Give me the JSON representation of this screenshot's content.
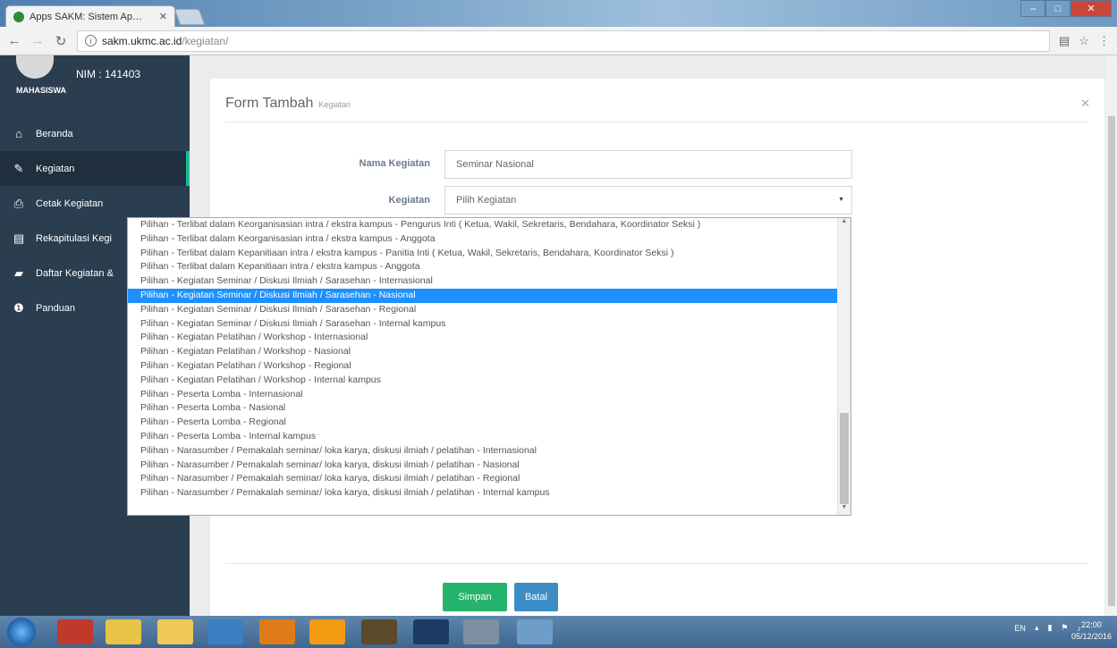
{
  "browser": {
    "tab_title": "Apps SAKM: Sistem Ap…",
    "url_host": "sakm.ukmc.ac.id",
    "url_path": "/kegiatan/"
  },
  "sidebar": {
    "nim": "NIM : 141403",
    "role": "MAHASISWA",
    "items": [
      {
        "label": "Beranda",
        "icon": "home-icon"
      },
      {
        "label": "Kegiatan",
        "icon": "edit-icon"
      },
      {
        "label": "Cetak Kegiatan",
        "icon": "print-icon"
      },
      {
        "label": "Rekapitulasi Kegi",
        "icon": "file-icon"
      },
      {
        "label": "Daftar Kegiatan &",
        "icon": "folder-icon"
      },
      {
        "label": "Panduan",
        "icon": "info-icon"
      }
    ]
  },
  "form": {
    "title": "Form Tambah",
    "subtitle": "Kegiatan",
    "nama_label": "Nama Kegiatan",
    "nama_value": "Seminar Nasional",
    "kegiatan_label": "Kegiatan",
    "kegiatan_value": "Pilih Kegiatan",
    "save_label": "Simpan",
    "cancel_label": "Batal"
  },
  "dropdown": {
    "selected_index": 5,
    "options": [
      "Pilihan - Terlibat dalam Keorganisasian intra / ekstra kampus - Pengurus Inti ( Ketua, Wakil, Sekretaris, Bendahara, Koordinator Seksi )",
      "Pilihan - Terlibat dalam Keorganisasian intra / ekstra kampus - Anggota",
      "Pilihan - Terlibat dalam Kepanitiaan intra / ekstra kampus - Panitia Inti ( Ketua, Wakil, Sekretaris, Bendahara, Koordinator Seksi )",
      "Pilihan - Terlibat dalam Kepanitiaan intra / ekstra kampus - Anggota",
      "Pilihan - Kegiatan Seminar / Diskusi Ilmiah / Sarasehan - Internasional",
      "Pilihan - Kegiatan Seminar / Diskusi Ilmiah / Sarasehan - Nasional",
      "Pilihan - Kegiatan Seminar / Diskusi Ilmiah / Sarasehan - Regional",
      "Pilihan - Kegiatan Seminar / Diskusi Ilmiah / Sarasehan - Internal kampus",
      "Pilihan - Kegiatan Pelatihan / Workshop - Internasional",
      "Pilihan - Kegiatan Pelatihan / Workshop - Nasional",
      "Pilihan - Kegiatan Pelatihan / Workshop - Regional",
      "Pilihan - Kegiatan Pelatihan / Workshop - Internal kampus",
      "Pilihan - Peserta Lomba - Internasional",
      "Pilihan - Peserta Lomba - Nasional",
      "Pilihan - Peserta Lomba - Regional",
      "Pilihan - Peserta Lomba - Internal kampus",
      "Pilihan - Narasumber / Pemakalah seminar/ loka karya, diskusi ilmiah / pelatihan - Internasional",
      "Pilihan - Narasumber / Pemakalah seminar/ loka karya, diskusi ilmiah / pelatihan - Nasional",
      "Pilihan - Narasumber / Pemakalah seminar/ loka karya, diskusi ilmiah / pelatihan - Regional",
      "Pilihan - Narasumber / Pemakalah seminar/ loka karya, diskusi ilmiah / pelatihan - Internal kampus"
    ]
  },
  "taskbar": {
    "lang": "EN",
    "time": "22:00",
    "date": "05/12/2016"
  },
  "colors": {
    "sidebar": "#2b3e50",
    "accent": "#1abc9c",
    "selected_option": "#1e90ff",
    "save_button": "#26b36b",
    "cancel_button": "#3c8dc5"
  }
}
